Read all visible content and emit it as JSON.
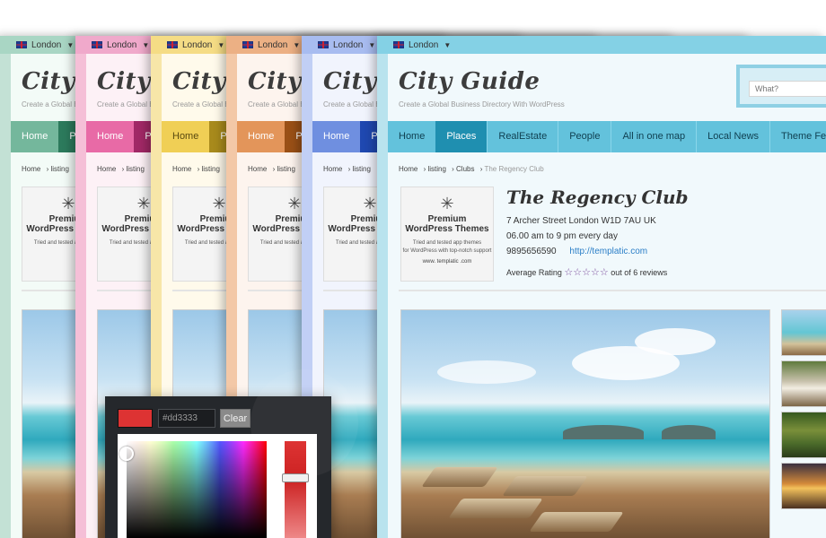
{
  "topbar": {
    "city": "London"
  },
  "site": {
    "title": "City Guide",
    "tagline": "Create a Global Business Directory With WordPress"
  },
  "nav": {
    "items": [
      "Home",
      "Places",
      "RealEstate",
      "People",
      "All in one map",
      "Local News",
      "Theme Features"
    ],
    "back_second_label": "Pl"
  },
  "search": {
    "placeholder": "What?"
  },
  "breadcrumb": [
    "Home",
    "listing",
    "Clubs",
    "The Regency Club"
  ],
  "ad": {
    "line1": "Premium",
    "line2": "WordPress Themes",
    "line3": "Tried and tested app themes",
    "line4": "for WordPress with top-notch support",
    "url": "www. templatic .com"
  },
  "listing": {
    "title": "The Regency Club",
    "address": "7 Archer Street London W1D 7AU UK",
    "hours": "06.00 am to 9 pm every day",
    "phone": "9895656590",
    "website": "http://templatic.com",
    "rating_label": "Average Rating",
    "rating_stars": "☆☆☆☆☆",
    "reviews": "out of 6 reviews"
  },
  "picker": {
    "hex_value": "#dd3333",
    "clear_label": "Clear"
  },
  "colors": {
    "green": "#5fa88f",
    "pink": "#e86aa6",
    "yellow": "#e8c84c",
    "orange": "#e3955a",
    "blue": "#6f8fe0",
    "cyan": "#63c2dc",
    "active": "#1f8fb0",
    "swatch": "#dd3333"
  }
}
